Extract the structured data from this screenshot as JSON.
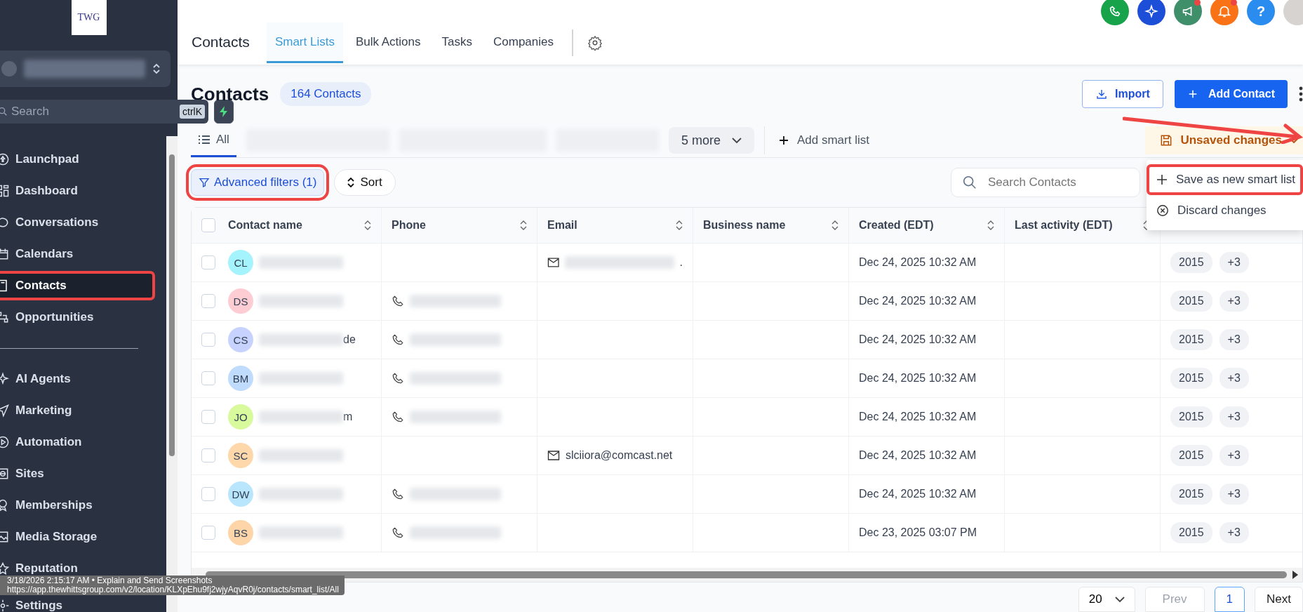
{
  "sidebar": {
    "logo": "TWG",
    "search": {
      "placeholder": "Search",
      "shortcut": "ctrlK"
    },
    "items": [
      {
        "label": "Launchpad",
        "selected": false,
        "annotated": false
      },
      {
        "label": "Dashboard",
        "selected": false,
        "annotated": false
      },
      {
        "label": "Conversations",
        "selected": false,
        "annotated": false
      },
      {
        "label": "Calendars",
        "selected": false,
        "annotated": false
      },
      {
        "label": "Contacts",
        "selected": true,
        "annotated": true
      },
      {
        "label": "Opportunities",
        "selected": false,
        "annotated": false
      }
    ],
    "items_2": [
      {
        "label": "AI Agents",
        "selected": false
      },
      {
        "label": "Marketing",
        "selected": false
      },
      {
        "label": "Automation",
        "selected": false
      },
      {
        "label": "Sites",
        "selected": false
      },
      {
        "label": "Memberships",
        "selected": false
      },
      {
        "label": "Media Storage",
        "selected": false
      },
      {
        "label": "Reputation",
        "selected": false
      },
      {
        "label": "Settings",
        "selected": false
      }
    ]
  },
  "topbar": {
    "title": "Contacts",
    "tabs": [
      {
        "label": "Smart Lists",
        "selected": true
      },
      {
        "label": "Bulk Actions",
        "selected": false
      },
      {
        "label": "Tasks",
        "selected": false
      },
      {
        "label": "Companies",
        "selected": false
      }
    ],
    "icons": [
      {
        "kind": "phone",
        "color": "#16a34a",
        "dot": false
      },
      {
        "kind": "sparkle",
        "color": "#1d4ed8",
        "dot": false
      },
      {
        "kind": "megaphone",
        "color": "#3f8f6b",
        "dot": true
      },
      {
        "kind": "bell",
        "color": "#f97316",
        "dot": true
      },
      {
        "kind": "help",
        "color": "#2b8cf0",
        "dot": false,
        "text": "?"
      },
      {
        "kind": "avatar",
        "color": "#d6d3d1",
        "dot": false
      }
    ]
  },
  "header": {
    "title": "Contacts",
    "count": "164 Contacts",
    "import": "Import",
    "add": "Add Contact"
  },
  "lists": {
    "tabs": [
      {
        "label": "All",
        "selected": true
      }
    ],
    "more": "5 more",
    "add": "Add smart list",
    "unsaved": "Unsaved changes"
  },
  "menu": [
    {
      "label": "Save as new smart list",
      "annotated": true
    },
    {
      "label": "Discard changes",
      "annotated": false
    }
  ],
  "filters": {
    "advanced": "Advanced filters (1)",
    "advanced_annotated": true,
    "sort": "Sort",
    "search_placeholder": "Search Contacts"
  },
  "table": {
    "select_all_checked": false,
    "columns": [
      "Contact name",
      "Phone",
      "Email",
      "Business name",
      "Created (EDT)",
      "Last activity (EDT)"
    ],
    "rows": [
      {
        "initials": "CL",
        "color": "#a5f3fc",
        "checked": false,
        "name_tail": "",
        "has_phone": false,
        "email": "",
        "email_blurred": true,
        "email_tail": ".",
        "created": "Dec 24, 2025 10:32 AM",
        "tags": [
          "2015",
          "+3"
        ]
      },
      {
        "initials": "DS",
        "color": "#fecdd3",
        "checked": false,
        "name_tail": "",
        "has_phone": true,
        "email": "",
        "email_blurred": false,
        "email_tail": "",
        "created": "Dec 24, 2025 10:32 AM",
        "tags": [
          "2015",
          "+3"
        ]
      },
      {
        "initials": "CS",
        "color": "#c7d2fe",
        "checked": false,
        "name_tail": "de",
        "has_phone": true,
        "email": "",
        "email_blurred": false,
        "email_tail": "",
        "created": "Dec 24, 2025 10:32 AM",
        "tags": [
          "2015",
          "+3"
        ]
      },
      {
        "initials": "BM",
        "color": "#bfdbfe",
        "checked": false,
        "name_tail": "",
        "has_phone": true,
        "email": "",
        "email_blurred": false,
        "email_tail": "",
        "created": "Dec 24, 2025 10:32 AM",
        "tags": [
          "2015",
          "+3"
        ]
      },
      {
        "initials": "JO",
        "color": "#d9f99d",
        "checked": false,
        "name_tail": "m",
        "has_phone": true,
        "email": "",
        "email_blurred": false,
        "email_tail": "",
        "created": "Dec 24, 2025 10:32 AM",
        "tags": [
          "2015",
          "+3"
        ]
      },
      {
        "initials": "SC",
        "color": "#fed7aa",
        "checked": false,
        "name_tail": "",
        "has_phone": false,
        "email": "slciiora@comcast.net",
        "email_blurred": false,
        "email_tail": "",
        "created": "Dec 24, 2025 10:32 AM",
        "tags": [
          "2015",
          "+3"
        ]
      },
      {
        "initials": "DW",
        "color": "#bae6fd",
        "checked": false,
        "name_tail": "",
        "has_phone": true,
        "email": "",
        "email_blurred": false,
        "email_tail": "",
        "created": "Dec 24, 2025 10:32 AM",
        "tags": [
          "2015",
          "+3"
        ]
      },
      {
        "initials": "BS",
        "color": "#fdd5a8",
        "checked": false,
        "name_tail": "",
        "has_phone": true,
        "email": "",
        "email_blurred": false,
        "email_tail": "",
        "created": "Dec 23, 2025 03:07 PM",
        "tags": [
          "2015",
          "+3"
        ]
      }
    ]
  },
  "pagination": {
    "page_size": "20",
    "prev": "Prev",
    "page": "1",
    "next": "Next"
  },
  "tooltip": {
    "line_1": "3/18/2026 2:15:17 AM • Explain and Send Screenshots",
    "line_2": "https://app.thewhittsgroup.com/v2/location/KLXpEhu9fj2wjyAqvR0j/contacts/smart_list/All"
  }
}
